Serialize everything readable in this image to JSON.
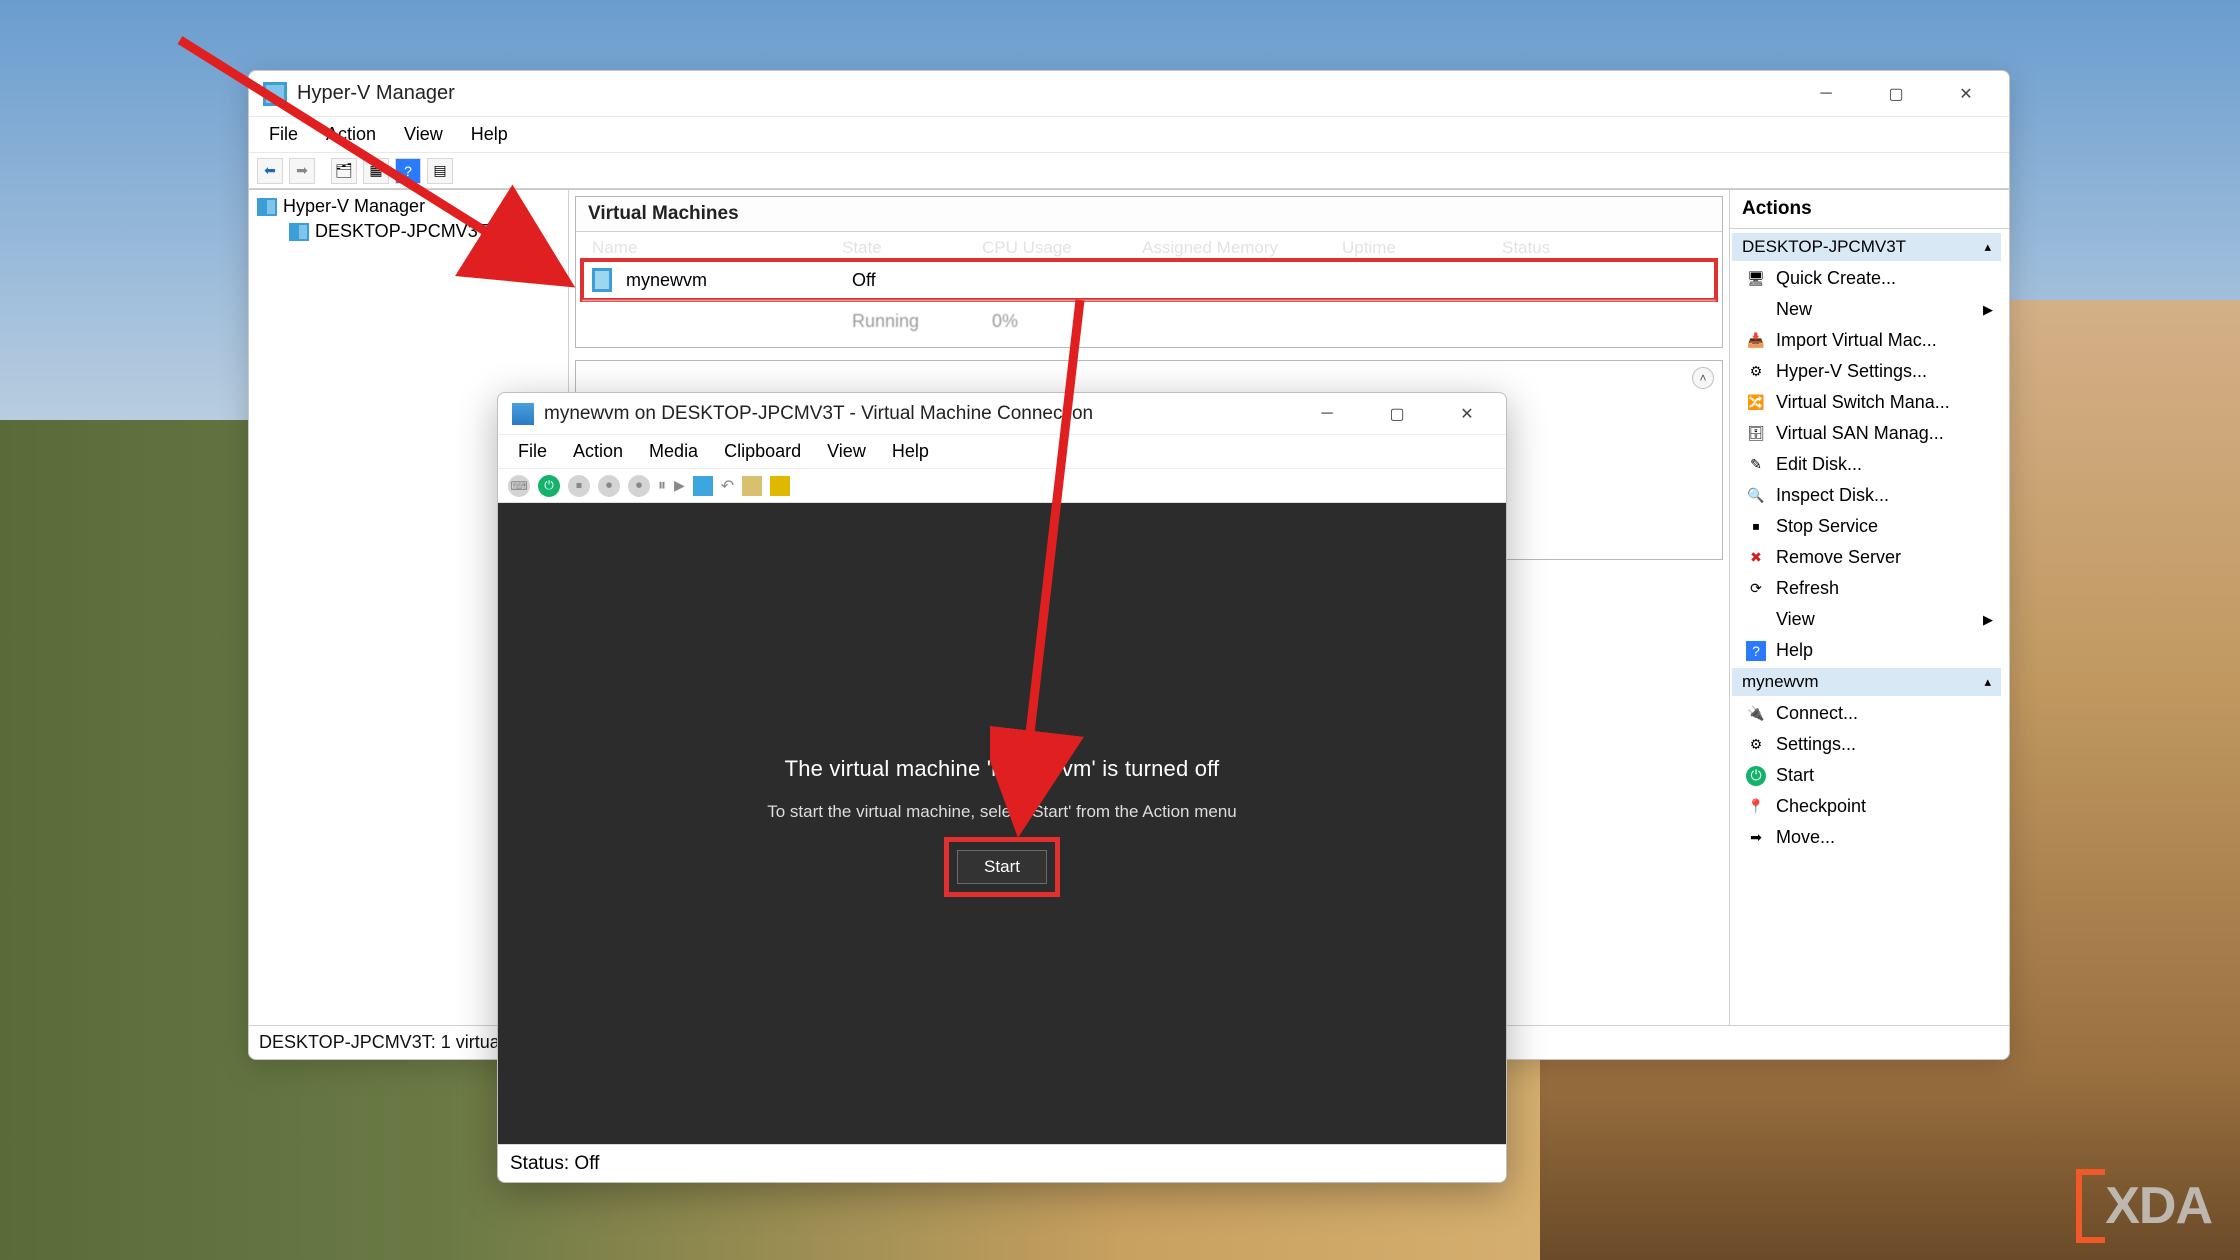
{
  "hv": {
    "title": "Hyper-V Manager",
    "menu": {
      "file": "File",
      "action": "Action",
      "view": "View",
      "help": "Help"
    },
    "tree": {
      "root": "Hyper-V Manager",
      "host": "DESKTOP-JPCMV3T"
    },
    "center": {
      "section": "Virtual Machines",
      "cols": {
        "name": "Name",
        "state": "State",
        "cpu": "CPU Usage",
        "mem": "Assigned Memory",
        "uptime": "Uptime",
        "status": "Status"
      },
      "rows": [
        {
          "name": "mynewvm",
          "state": "Off",
          "cpu": "",
          "mem": "",
          "uptime": "",
          "status": ""
        },
        {
          "name": " ",
          "state": "Running",
          "cpu": "0%",
          "mem": " ",
          "uptime": " ",
          "status": ""
        }
      ]
    },
    "actions": {
      "header": "Actions",
      "group_host": "DESKTOP-JPCMV3T",
      "host_items": [
        {
          "label": "Quick Create...",
          "icon": "🖥"
        },
        {
          "label": "New",
          "icon": "",
          "chevron": true
        },
        {
          "label": "Import Virtual Mac...",
          "icon": "📥"
        },
        {
          "label": "Hyper-V Settings...",
          "icon": "⚙"
        },
        {
          "label": "Virtual Switch Mana...",
          "icon": "🔀"
        },
        {
          "label": "Virtual SAN Manag...",
          "icon": "🗄"
        },
        {
          "label": "Edit Disk...",
          "icon": "✎"
        },
        {
          "label": "Inspect Disk...",
          "icon": "🔍"
        },
        {
          "label": "Stop Service",
          "icon": "⏹"
        },
        {
          "label": "Remove Server",
          "icon": "✖",
          "red": true
        },
        {
          "label": "Refresh",
          "icon": "⟳"
        },
        {
          "label": "View",
          "icon": "",
          "chevron": true
        },
        {
          "label": "Help",
          "icon": "?"
        }
      ],
      "group_vm": "mynewvm",
      "vm_items": [
        {
          "label": "Connect...",
          "icon": "🔌"
        },
        {
          "label": "Settings...",
          "icon": "⚙"
        },
        {
          "label": "Start",
          "icon": "⏻"
        },
        {
          "label": "Checkpoint",
          "icon": "📍"
        },
        {
          "label": "Move...",
          "icon": "➡"
        }
      ]
    },
    "status": "DESKTOP-JPCMV3T:  1 virtual m"
  },
  "vmc": {
    "title": "mynewvm on DESKTOP-JPCMV3T - Virtual Machine Connection",
    "menu": {
      "file": "File",
      "action": "Action",
      "media": "Media",
      "clipboard": "Clipboard",
      "view": "View",
      "help": "Help"
    },
    "msg1": "The virtual machine 'mynewvm' is turned off",
    "msg2": "To start the virtual machine, select 'Start' from the Action menu",
    "start": "Start",
    "status": "Status: Off"
  },
  "watermark": {
    "left": "[",
    "text": "XDA"
  }
}
